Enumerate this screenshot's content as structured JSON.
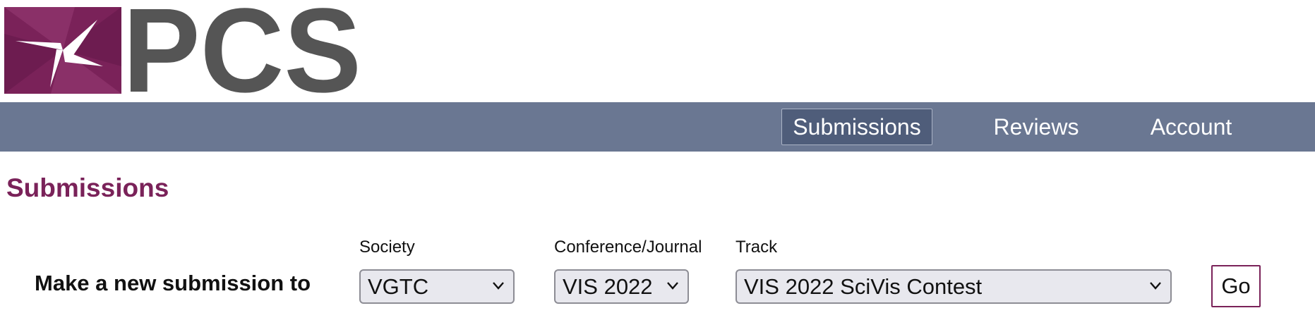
{
  "logo": {
    "text": "PCS",
    "colors": {
      "mark": "#7a2259",
      "text": "#555555"
    }
  },
  "nav": {
    "items": [
      {
        "label": "Submissions",
        "active": true
      },
      {
        "label": "Reviews",
        "active": false
      },
      {
        "label": "Account",
        "active": false
      }
    ],
    "background": "#6a7792"
  },
  "page": {
    "title": "Submissions",
    "title_color": "#7a2259"
  },
  "form": {
    "make_label": "Make a new submission to",
    "society": {
      "label": "Society",
      "value": "VGTC"
    },
    "conference": {
      "label": "Conference/Journal",
      "value": "VIS 2022"
    },
    "track": {
      "label": "Track",
      "value": "VIS 2022 SciVis Contest"
    },
    "go_label": "Go"
  },
  "icons": {
    "select_arrow": "chevron-down-icon"
  }
}
